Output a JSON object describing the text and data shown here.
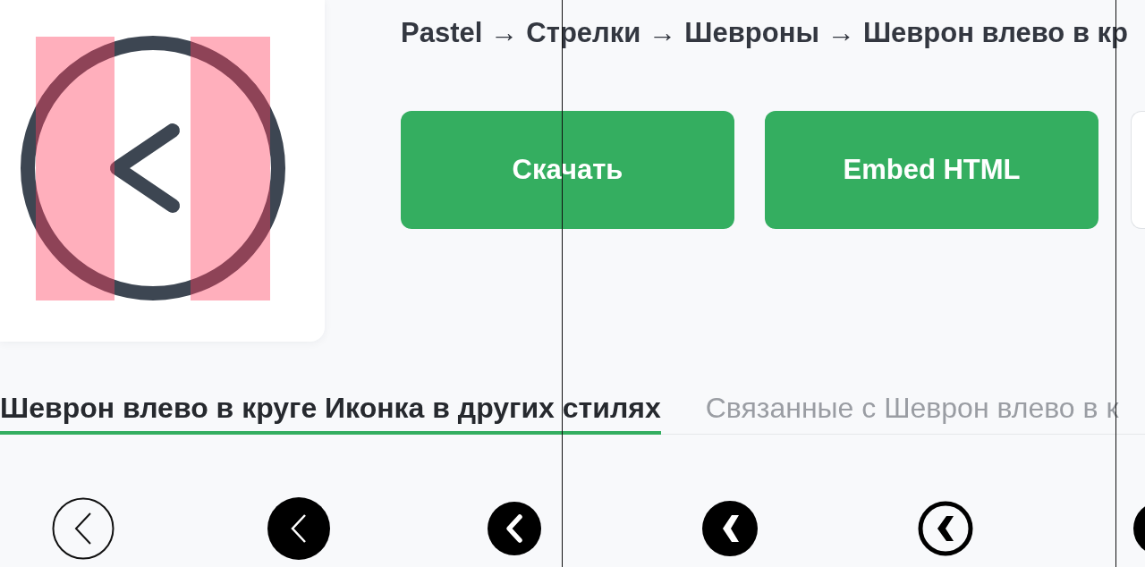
{
  "breadcrumb": [
    {
      "label": "Pastel"
    },
    {
      "separator": "→",
      "label": "Стрелки"
    },
    {
      "separator": "→",
      "label": "Шевроны"
    },
    {
      "separator": "→",
      "label": "Шеврон влево в кр"
    }
  ],
  "buttons": [
    {
      "kind": "primary",
      "label": "Скачать"
    },
    {
      "kind": "primary",
      "label": "Embed HTML"
    },
    {
      "kind": "outline"
    }
  ],
  "tabs": [
    {
      "label": "Шеврон влево в круге Иконка в других стилях",
      "selected": true
    },
    {
      "label": "Связанные с Шеврон влево в к",
      "selected": false
    }
  ],
  "style_icons": [
    {
      "kind": "outline"
    },
    {
      "kind": "filled"
    },
    {
      "kind": "solid"
    },
    {
      "kind": "bold"
    },
    {
      "kind": "ring"
    },
    {
      "kind": "solid"
    }
  ]
}
